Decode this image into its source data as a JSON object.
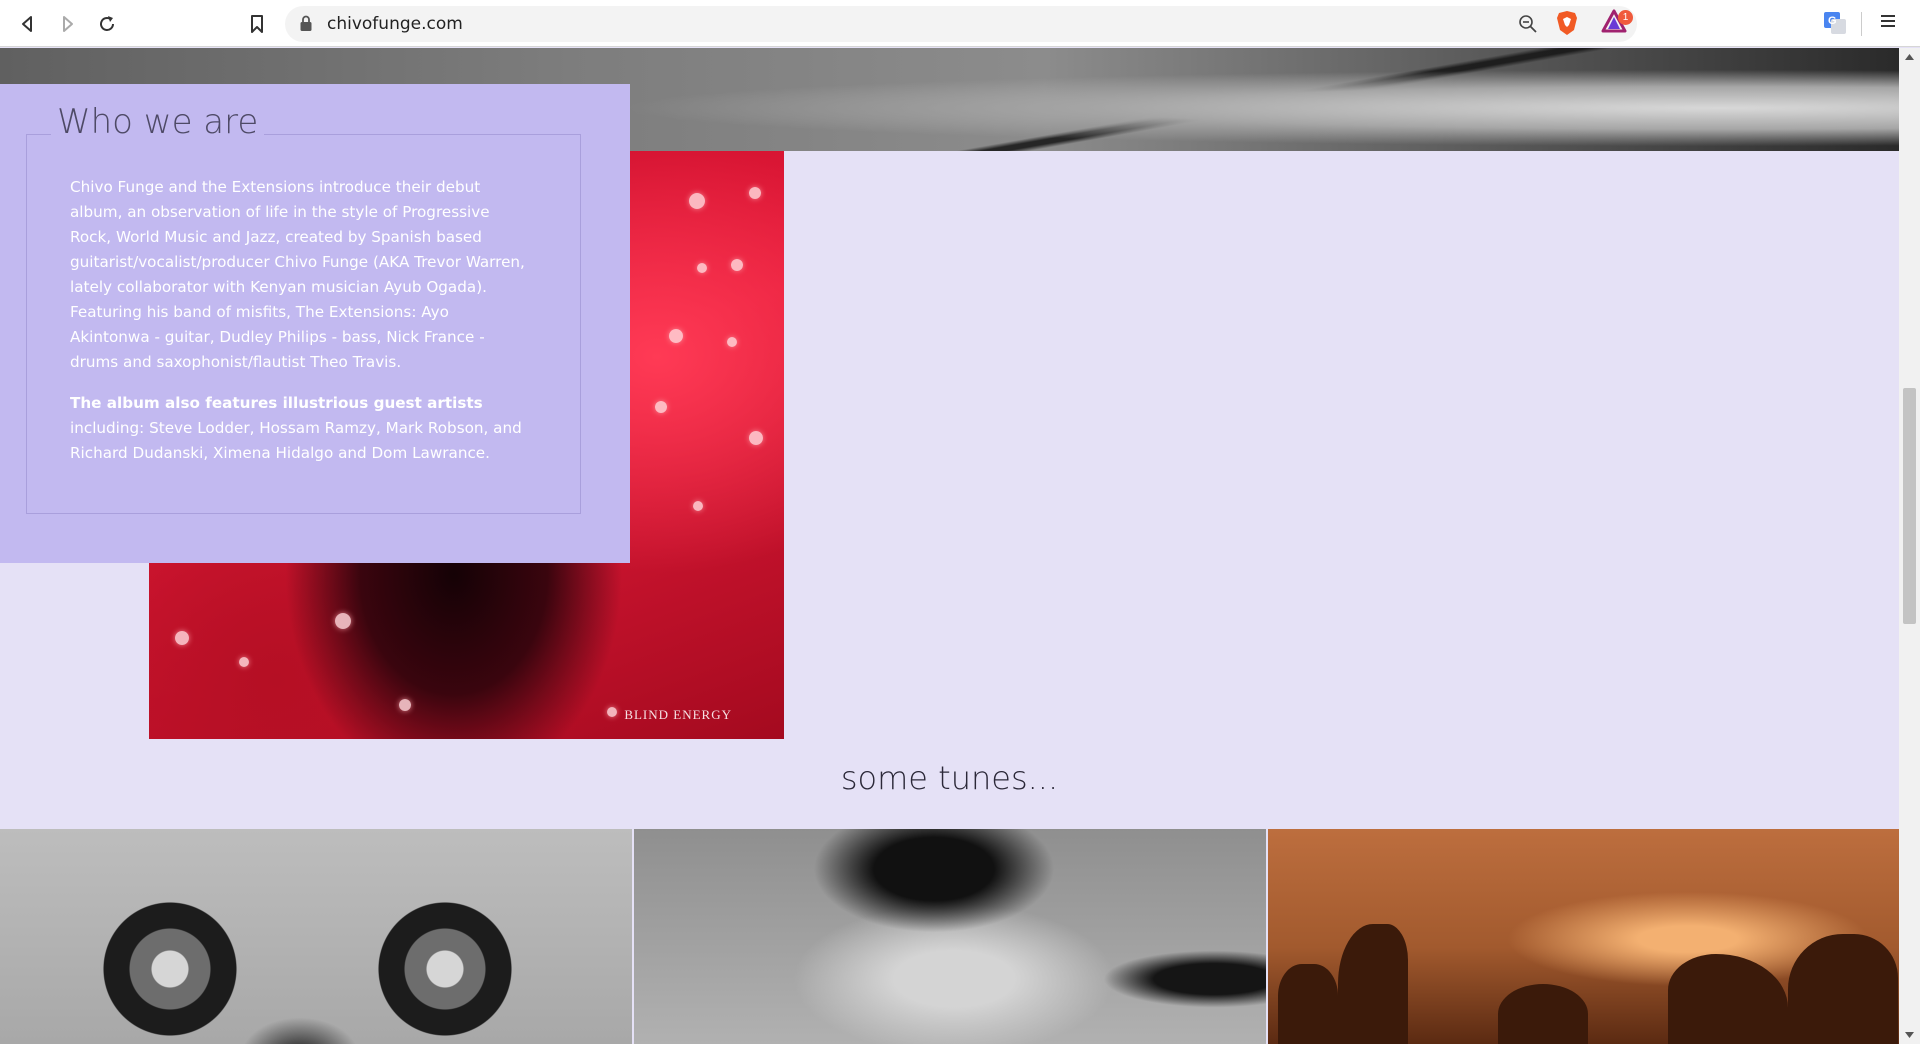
{
  "browser": {
    "url": "chivofunge.com",
    "rewards_badge": "1",
    "icons": [
      "back-icon",
      "forward-icon",
      "reload-icon",
      "bookmark-icon",
      "lock-icon",
      "zoom-out-icon",
      "brave-shields-icon",
      "brave-rewards-icon",
      "google-translate-icon",
      "menu-icon"
    ]
  },
  "who_we_are": {
    "title": "Who we are",
    "paragraph1": "Chivo Funge and the Extensions introduce their debut album, an observation of life in the style of Progressive Rock, World Music and Jazz, created by Spanish based guitarist/vocalist/producer Chivo Funge (AKA Trevor Warren, lately collaborator with Kenyan musician Ayub Ogada). Featuring his band of misfits, The Extensions: Ayo Akintonwa - guitar, Dudley Philips - bass, Nick France - drums and saxophonist/flautist Theo Travis.",
    "paragraph2_bold": "The album also features illustrious guest artists",
    "paragraph2_rest": " including: Steve Lodder, Hossam Ramzy, Mark Robson, and Richard Dudanski, Ximena Hidalgo and Dom Lawrance."
  },
  "album": {
    "caption": "BLIND ENERGY"
  },
  "tunes": {
    "heading": "some tunes..."
  },
  "colors": {
    "page_bg": "#e5e1f6",
    "who_box_bg": "#c2b9f0"
  }
}
